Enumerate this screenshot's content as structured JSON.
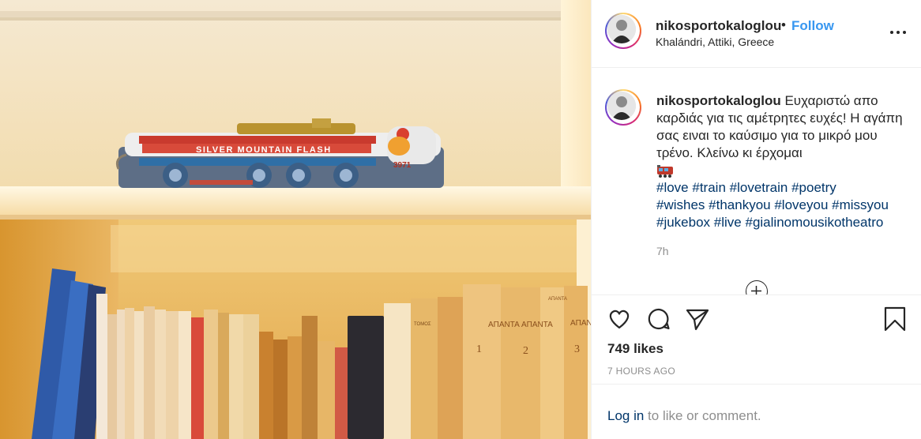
{
  "post": {
    "username": "nikosportokaloglou",
    "separator": "•",
    "follow_label": "Follow",
    "location": "Khalándri, Attiki, Greece",
    "more_icon": "more-options-icon"
  },
  "caption": {
    "username": "nikosportokaloglou",
    "text": "Ευχαριστώ απο καρδιάς για τις αμέτρητες ευχές! Η αγάπη σας ειναι το καύσιμο για το μικρό μου τρένο. Κλείνω κι έρχομαι",
    "emoji": "train-emoji",
    "hashtags": [
      "#love",
      "#train",
      "#lovetrain",
      "#poetry",
      "#wishes",
      "#thankyou",
      "#loveyou",
      "#missyou",
      "#jukebox",
      "#live",
      "#gialinomousikotheatro"
    ],
    "time": "7h"
  },
  "photo": {
    "train_text": "SILVER MOUNTAIN FLASH",
    "train_number": "3971",
    "spine_texts": [
      "ΑΠΑΝΤΑ",
      "1",
      "ΑΠΑΝΤΑ",
      "2",
      "ΑΠΑΝ",
      "3",
      "ΑΠΑΝΤΑ",
      "ΤΟΜΟΣ"
    ]
  },
  "actions": {
    "like_icon": "heart-icon",
    "comment_icon": "comment-icon",
    "share_icon": "share-icon",
    "save_icon": "bookmark-icon",
    "likes": "749 likes",
    "posted": "7 HOURS AGO"
  },
  "login": {
    "link": "Log in",
    "rest": " to like or comment."
  },
  "colors": {
    "link_blue": "#003569",
    "follow_blue": "#3897f0",
    "muted": "#8e8e8e"
  }
}
